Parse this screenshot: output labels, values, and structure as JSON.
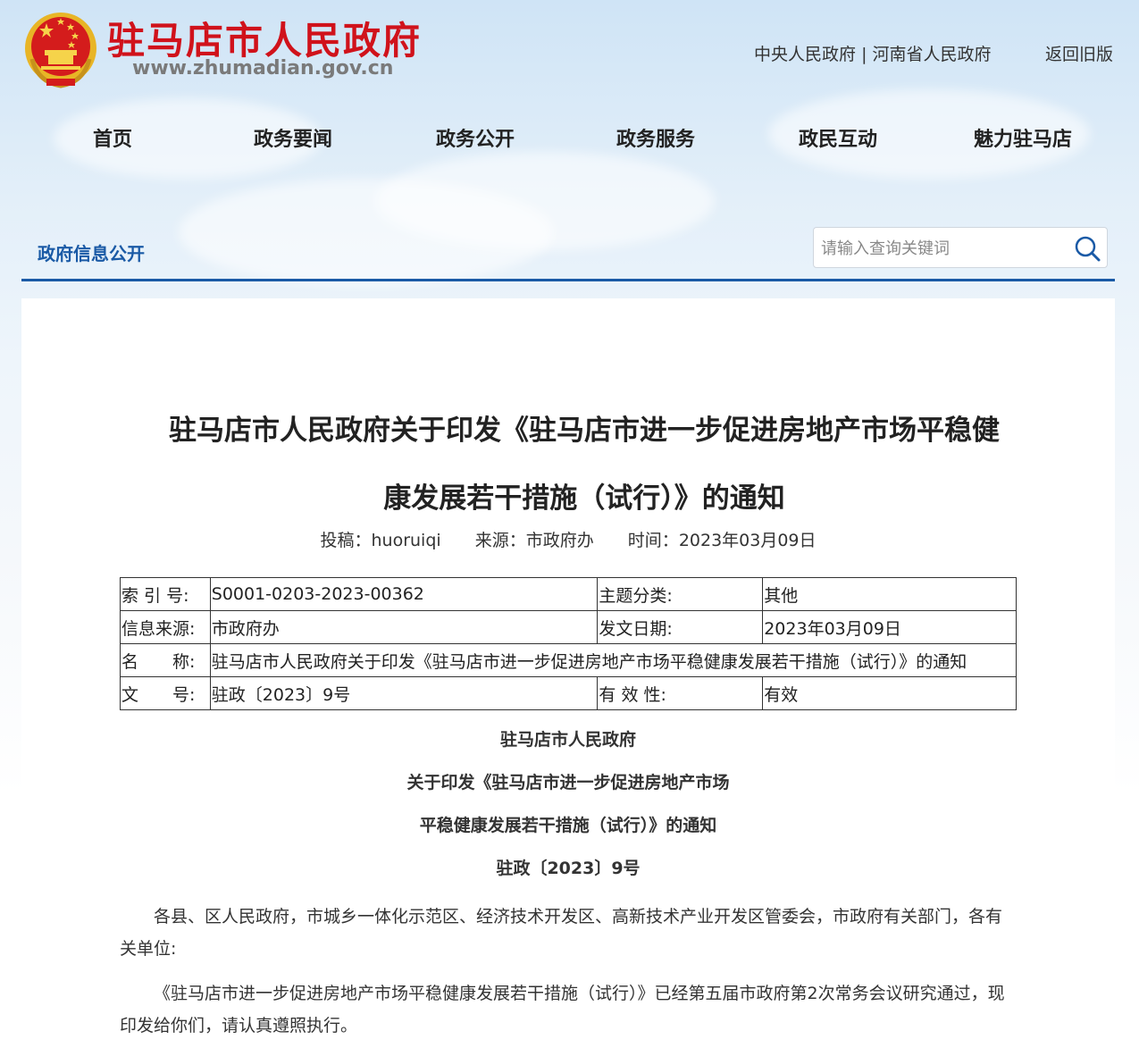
{
  "header": {
    "site_title": "驻马店市人民政府",
    "site_url": "www.zhumadian.gov.cn",
    "link_central": "中央人民政府",
    "link_separator": "|",
    "link_province": "河南省人民政府",
    "link_old": "返回旧版"
  },
  "nav": {
    "items": [
      "首页",
      "政务要闻",
      "政务公开",
      "政务服务",
      "政民互动",
      "魅力驻马店"
    ]
  },
  "section": {
    "title": "政府信息公开"
  },
  "search": {
    "placeholder": "请输入查询关键词",
    "value": ""
  },
  "article": {
    "title": "驻马店市人民政府关于印发《驻马店市进一步促进房地产市场平稳健康发展若干措施（试行）》的通知",
    "meta": {
      "author_label": "投稿：",
      "author": "huoruiqi",
      "source_label": "来源：",
      "source": "市政府办",
      "time_label": "时间：",
      "time": "2023年03月09日"
    },
    "info_table": {
      "index_label": "索 引 号:",
      "index_value": "S0001-0203-2023-00362",
      "topic_label": "主题分类:",
      "topic_value": "其他",
      "info_source_label": "信息来源:",
      "info_source_value": "市政府办",
      "issue_date_label": "发文日期:",
      "issue_date_value": "2023年03月09日",
      "name_label": "名　　称:",
      "name_value": "驻马店市人民政府关于印发《驻马店市进一步促进房地产市场平稳健康发展若干措施（试行）》的通知",
      "doc_no_label": "文　　号:",
      "doc_no_value": "驻政〔2023〕9号",
      "validity_label": "有 效 性:",
      "validity_value": "有效"
    },
    "body": {
      "issuer": "驻马店市人民政府",
      "heading_line1": "关于印发《驻马店市进一步促进房地产市场",
      "heading_line2": "平稳健康发展若干措施（试行）》的通知",
      "doc_number": "驻政〔2023〕9号",
      "recipients": "各县、区人民政府，市城乡一体化示范区、经济技术开发区、高新技术产业开发区管委会，市政府有关部门，各有关单位:",
      "paragraph1": "《驻马店市进一步促进房地产市场平稳健康发展若干措施（试行）》已经第五届市政府第2次常务会议研究通过，现印发给你们，请认真遵照执行。"
    }
  },
  "colors": {
    "title_red": "#d0121b",
    "brand_blue": "#1a5aa6"
  }
}
